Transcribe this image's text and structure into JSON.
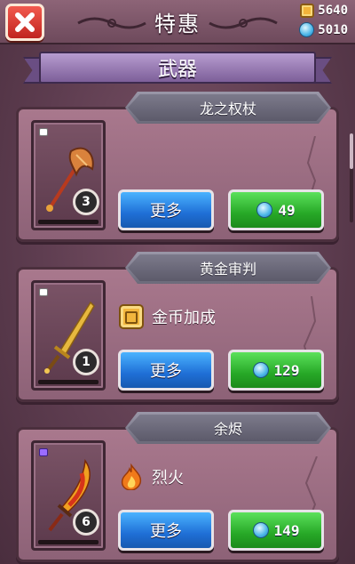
{
  "header": {
    "title": "特惠",
    "gold": "5640",
    "gems": "5010"
  },
  "category": {
    "label": "武器"
  },
  "items": [
    {
      "name": "龙之权杖",
      "level": "3",
      "rarity": "white",
      "weapon_icon": "axe-staff-icon",
      "perk": null,
      "more_label": "更多",
      "price": "49",
      "progress": 0.0
    },
    {
      "name": "黄金审判",
      "level": "1",
      "rarity": "white",
      "weapon_icon": "golden-sword-icon",
      "perk": {
        "label": "金币加成",
        "icon": "gold-coin-icon"
      },
      "more_label": "更多",
      "price": "129",
      "progress": 0.0
    },
    {
      "name": "余烬",
      "level": "6",
      "rarity": "purple",
      "weapon_icon": "flame-blade-icon",
      "perk": {
        "label": "烈火",
        "icon": "fire-icon"
      },
      "more_label": "更多",
      "price": "149",
      "progress": 0.0
    }
  ],
  "colors": {
    "more_button": "#2a8cf0",
    "buy_button": "#2fbf2f",
    "close_button": "#e0362c"
  }
}
